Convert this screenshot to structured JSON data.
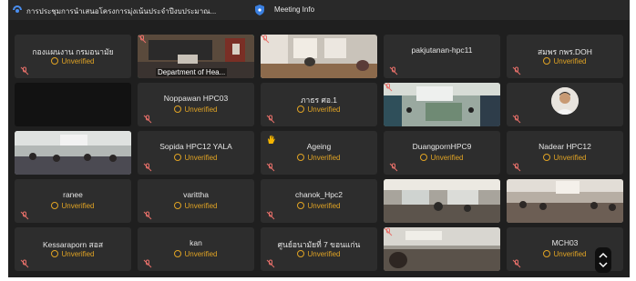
{
  "titlebar": {
    "meeting_title": "การประชุมการนำเสนอโครงการมุ่งเน้นประจำปีงบประมาณ...",
    "meeting_info_label": "Meeting Info"
  },
  "status_label": "Unverified",
  "tiles": [
    {
      "name": "กองแผนงาน กรมอนามัย"
    },
    {
      "caption": "Department of Hea..."
    },
    {},
    {
      "name": "pakjutanan-hpc11"
    },
    {
      "name": "สมพร กพร.DOH"
    },
    {},
    {
      "name": "Noppawan HPC03"
    },
    {
      "name": "ภาธร ศอ.1"
    },
    {},
    {},
    {},
    {
      "name": "Sopida HPC12 YALA"
    },
    {
      "name": "Ageing"
    },
    {
      "name": "DuangpornHPC9"
    },
    {
      "name": "Nadear HPC12"
    },
    {
      "name": "ranee"
    },
    {
      "name": "varittha"
    },
    {
      "name": "chanok_Hpc2"
    },
    {},
    {},
    {
      "name": "Kessaraporn สอส"
    },
    {
      "name": "kan"
    },
    {
      "name": "ศูนย์อนามัยที่ 7 ขอนแก่น"
    },
    {},
    {
      "name": "MCH03"
    }
  ]
}
